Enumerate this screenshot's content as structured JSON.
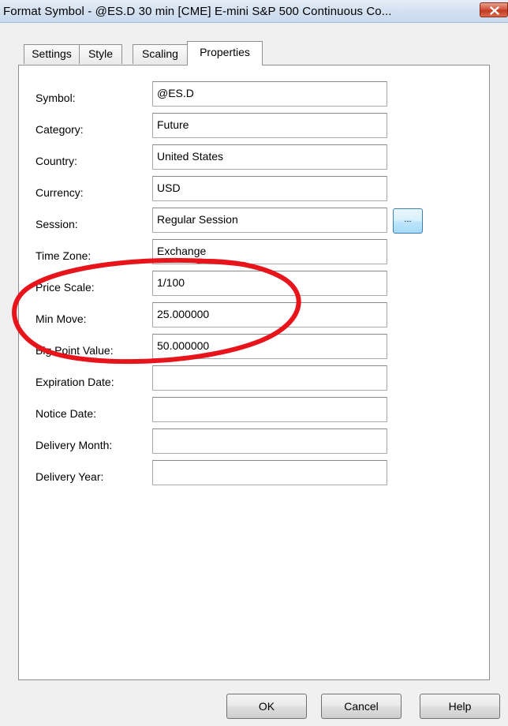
{
  "window": {
    "title": "Format Symbol - @ES.D 30 min [CME] E-mini S&P 500 Continuous Co..."
  },
  "tabs": [
    {
      "label": "Settings",
      "active": false
    },
    {
      "label": "Style",
      "active": false
    },
    {
      "label": "Scaling",
      "active": false
    },
    {
      "label": "Properties",
      "active": true
    }
  ],
  "properties": {
    "symbol": {
      "label": "Symbol:",
      "value": "@ES.D"
    },
    "category": {
      "label": "Category:",
      "value": "Future"
    },
    "country": {
      "label": "Country:",
      "value": "United States"
    },
    "currency": {
      "label": "Currency:",
      "value": "USD"
    },
    "session": {
      "label": "Session:",
      "value": "Regular Session"
    },
    "time_zone": {
      "label": "Time Zone:",
      "value": "Exchange"
    },
    "price_scale": {
      "label": "Price Scale:",
      "value": "1/100"
    },
    "min_move": {
      "label": "Min Move:",
      "value": "25.000000"
    },
    "big_point_value": {
      "label": "Big Point Value:",
      "value": "50.000000"
    },
    "expiration_date": {
      "label": "Expiration Date:",
      "value": ""
    },
    "notice_date": {
      "label": "Notice Date:",
      "value": ""
    },
    "delivery_month": {
      "label": "Delivery Month:",
      "value": ""
    },
    "delivery_year": {
      "label": "Delivery Year:",
      "value": ""
    }
  },
  "session_browse_label": "...",
  "buttons": {
    "ok": "OK",
    "cancel": "Cancel",
    "help": "Help"
  },
  "icons": {
    "close": "close-icon"
  },
  "colors": {
    "annotation_ellipse": "#e8141b",
    "close_button": "#c9432b",
    "titlebar": "#d4e1f1"
  }
}
